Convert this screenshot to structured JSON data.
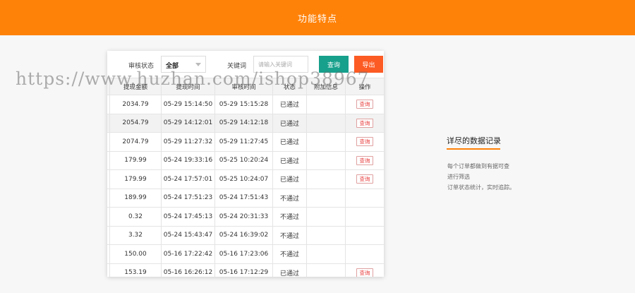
{
  "header": {
    "title": "功能特点"
  },
  "filter": {
    "status_label": "审核状态",
    "status_value": "全部",
    "keyword_label": "关键词",
    "keyword_placeholder": "请输入关键词",
    "query_button": "查询",
    "export_button": "导出"
  },
  "table": {
    "headers": [
      "提现金额",
      "提现时间",
      "审核时间",
      "状态",
      "附加信息",
      "操作"
    ],
    "rows": [
      {
        "amount": "2034.79",
        "withdraw_time": "05-29 15:14:50",
        "review_time": "05-29 15:15:28",
        "status": "已通过",
        "extra": "",
        "action": "查询"
      },
      {
        "amount": "2054.79",
        "withdraw_time": "05-29 14:12:01",
        "review_time": "05-29 14:12:18",
        "status": "已通过",
        "extra": "",
        "action": "查询"
      },
      {
        "amount": "2074.79",
        "withdraw_time": "05-29 11:27:32",
        "review_time": "05-29 11:27:45",
        "status": "已通过",
        "extra": "",
        "action": "查询"
      },
      {
        "amount": "179.99",
        "withdraw_time": "05-24 19:33:16",
        "review_time": "05-25 10:20:24",
        "status": "已通过",
        "extra": "",
        "action": "查询"
      },
      {
        "amount": "179.99",
        "withdraw_time": "05-24 17:57:01",
        "review_time": "05-25 10:24:07",
        "status": "已通过",
        "extra": "",
        "action": "查询"
      },
      {
        "amount": "189.99",
        "withdraw_time": "05-24 17:51:23",
        "review_time": "05-24 17:51:43",
        "status": "不通过",
        "extra": "",
        "action": ""
      },
      {
        "amount": "0.32",
        "withdraw_time": "05-24 17:45:13",
        "review_time": "05-24 20:31:33",
        "status": "不通过",
        "extra": "",
        "action": ""
      },
      {
        "amount": "3.32",
        "withdraw_time": "05-24 15:43:47",
        "review_time": "05-24 16:39:02",
        "status": "不通过",
        "extra": "",
        "action": ""
      },
      {
        "amount": "150.00",
        "withdraw_time": "05-16 17:22:42",
        "review_time": "05-16 17:23:06",
        "status": "不通过",
        "extra": "",
        "action": ""
      },
      {
        "amount": "153.19",
        "withdraw_time": "05-16 16:26:12",
        "review_time": "05-16 17:12:29",
        "status": "已通过",
        "extra": "",
        "action": "查询"
      }
    ]
  },
  "side": {
    "title": "详尽的数据记录",
    "lines": [
      "每个订单都做到有据可查",
      "进行筛选",
      "订单状态统计，实时追踪。"
    ]
  },
  "watermark": {
    "text": "https://www.huzhan.com/ishop38967"
  },
  "colors": {
    "accent": "#ff8208",
    "query": "#17a08c",
    "export": "#fc5b24",
    "action": "#e83b3b"
  }
}
